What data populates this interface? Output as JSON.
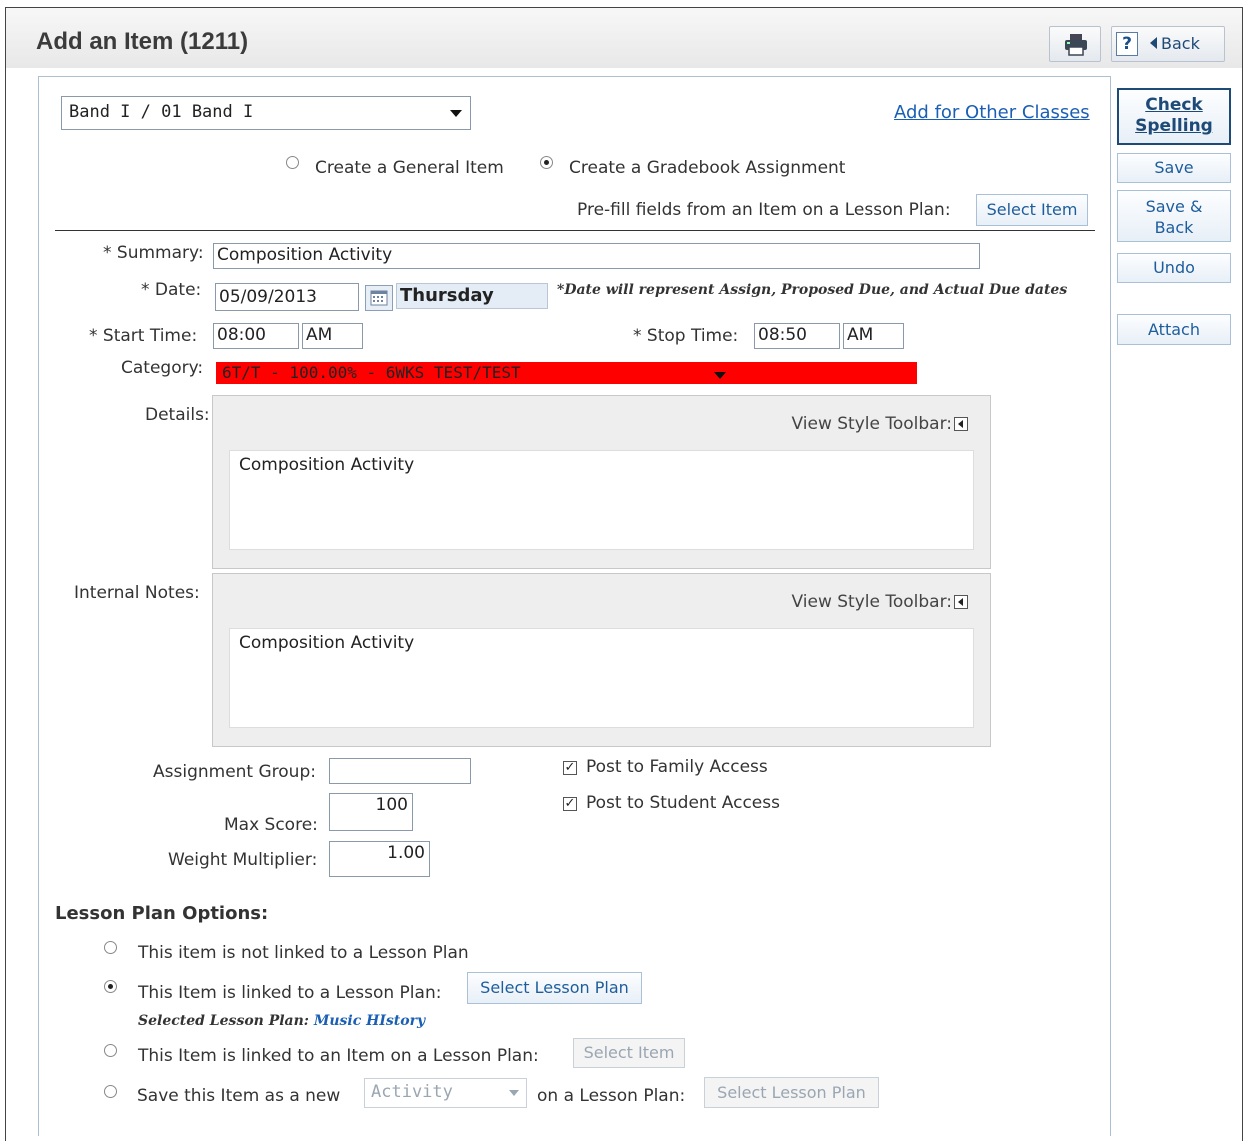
{
  "header": {
    "title": "Add an Item (1211)",
    "back_label": "Back",
    "help_label": "?"
  },
  "sidebar": {
    "check_spelling_line1": "Check",
    "check_spelling_line2": "Spelling",
    "save": "Save",
    "save_back_line1": "Save &",
    "save_back_line2": "Back",
    "undo": "Undo",
    "attach": "Attach"
  },
  "form": {
    "class_select": "Band I / 01 Band I",
    "add_other_classes": "Add for Other Classes",
    "item_type": {
      "general_label": "Create a General Item",
      "gradebook_label": "Create a Gradebook Assignment",
      "selected": "gradebook"
    },
    "prefill_label": "Pre-fill fields from an Item on a Lesson Plan:",
    "select_item": "Select Item",
    "summary_label": "* Summary:",
    "summary_value": "Composition Activity",
    "date_label": "* Date:",
    "date_value": "05/09/2013",
    "day_value": "Thursday",
    "date_note": "*Date will represent Assign, Proposed Due, and Actual Due dates",
    "start_time_label": "* Start Time:",
    "start_time_value": "08:00",
    "start_ampm": "AM",
    "stop_time_label": "* Stop Time:",
    "stop_time_value": "08:50",
    "stop_ampm": "AM",
    "category_label": "Category:",
    "category_value": "6T/T - 100.00% - 6WKS TEST/TEST",
    "category_color": "#ff0000",
    "details_label": "Details:",
    "details_toolbar": "View Style Toolbar:",
    "details_value": "Composition Activity",
    "notes_label": "Internal Notes:",
    "notes_toolbar": "View Style Toolbar:",
    "notes_value": "Composition Activity",
    "assignment_group_label": "Assignment Group:",
    "assignment_group_value": "",
    "max_score_label": "Max Score:",
    "max_score_value": "100",
    "weight_label": "Weight Multiplier:",
    "weight_value": "1.00",
    "post_family_label": "Post to Family Access",
    "post_family_checked": true,
    "post_student_label": "Post to Student Access",
    "post_student_checked": true
  },
  "lesson_plan": {
    "heading": "Lesson Plan Options:",
    "opt_not_linked": "This item is not linked to a Lesson Plan",
    "opt_linked": "This Item is linked to a Lesson Plan:",
    "select_lesson_plan": "Select Lesson Plan",
    "selected_label": "Selected Lesson Plan:",
    "selected_value": "Music HIstory",
    "opt_linked_item": "This Item is linked to an Item on a Lesson Plan:",
    "select_item": "Select Item",
    "opt_save_new_prefix": "Save this Item as a new",
    "activity_select": "Activity",
    "opt_save_new_suffix": "on a Lesson Plan:",
    "select_lesson_plan_2": "Select Lesson Plan",
    "selected_option": "linked"
  }
}
